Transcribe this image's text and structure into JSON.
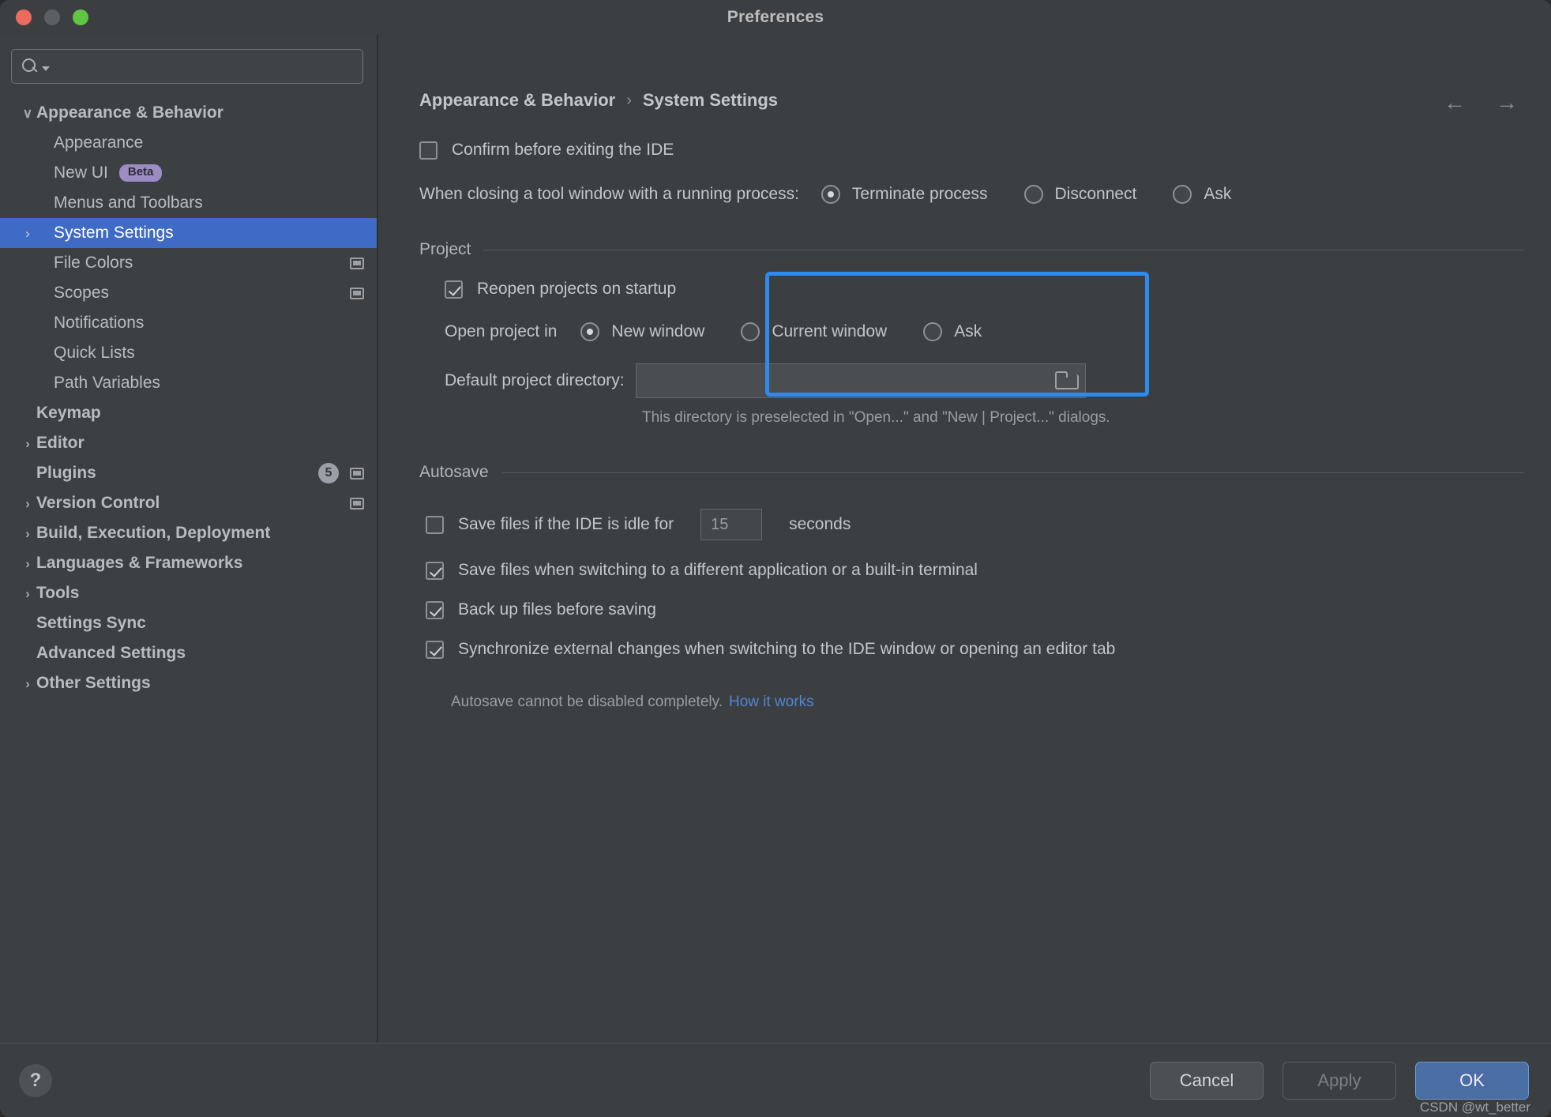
{
  "window": {
    "title": "Preferences",
    "traffic_lights": [
      "close",
      "minimize",
      "zoom"
    ]
  },
  "search": {
    "value": "",
    "placeholder": ""
  },
  "sidebar": {
    "items": [
      {
        "label": "Appearance & Behavior",
        "depth": 0,
        "arrow": "∨",
        "selected": false
      },
      {
        "label": "Appearance",
        "depth": 1,
        "arrow": "",
        "selected": false
      },
      {
        "label": "New UI",
        "depth": 1,
        "arrow": "",
        "selected": false,
        "badge": "Beta"
      },
      {
        "label": "Menus and Toolbars",
        "depth": 1,
        "arrow": "",
        "selected": false
      },
      {
        "label": "System Settings",
        "depth": 1,
        "arrow": "›",
        "selected": true
      },
      {
        "label": "File Colors",
        "depth": 1,
        "arrow": "",
        "selected": false,
        "scope_icon": true
      },
      {
        "label": "Scopes",
        "depth": 1,
        "arrow": "",
        "selected": false,
        "scope_icon": true
      },
      {
        "label": "Notifications",
        "depth": 1,
        "arrow": "",
        "selected": false
      },
      {
        "label": "Quick Lists",
        "depth": 1,
        "arrow": "",
        "selected": false
      },
      {
        "label": "Path Variables",
        "depth": 1,
        "arrow": "",
        "selected": false
      },
      {
        "label": "Keymap",
        "depth": 0,
        "arrow": "",
        "selected": false
      },
      {
        "label": "Editor",
        "depth": 0,
        "arrow": "›",
        "selected": false
      },
      {
        "label": "Plugins",
        "depth": 0,
        "arrow": "",
        "selected": false,
        "count": "5",
        "scope_icon": true
      },
      {
        "label": "Version Control",
        "depth": 0,
        "arrow": "›",
        "selected": false,
        "scope_icon": true
      },
      {
        "label": "Build, Execution, Deployment",
        "depth": 0,
        "arrow": "›",
        "selected": false
      },
      {
        "label": "Languages & Frameworks",
        "depth": 0,
        "arrow": "›",
        "selected": false
      },
      {
        "label": "Tools",
        "depth": 0,
        "arrow": "›",
        "selected": false
      },
      {
        "label": "Settings Sync",
        "depth": 0,
        "arrow": "",
        "selected": false
      },
      {
        "label": "Advanced Settings",
        "depth": 0,
        "arrow": "",
        "selected": false
      },
      {
        "label": "Other Settings",
        "depth": 0,
        "arrow": "›",
        "selected": false
      }
    ]
  },
  "breadcrumb": {
    "parent": "Appearance & Behavior",
    "separator": "›",
    "current": "System Settings"
  },
  "nav": {
    "back": "←",
    "forward": "→"
  },
  "main": {
    "confirm_exit": {
      "label": "Confirm before exiting the IDE",
      "checked": false
    },
    "closing_tool_window": {
      "label": "When closing a tool window with a running process:",
      "options": [
        {
          "label": "Terminate process",
          "selected": true
        },
        {
          "label": "Disconnect",
          "selected": false
        },
        {
          "label": "Ask",
          "selected": false
        }
      ]
    },
    "project": {
      "title": "Project",
      "reopen": {
        "label": "Reopen projects on startup",
        "checked": true
      },
      "open_project_in": {
        "label": "Open project in",
        "options": [
          {
            "label": "New window",
            "selected": true
          },
          {
            "label": "Current window",
            "selected": false
          },
          {
            "label": "Ask",
            "selected": false
          }
        ]
      },
      "default_directory": {
        "label": "Default project directory:",
        "value": "",
        "browse_icon": "folder-icon",
        "hint": "This directory is preselected in \"Open...\" and \"New | Project...\" dialogs."
      }
    },
    "autosave": {
      "title": "Autosave",
      "idle": {
        "label_before": "Save files if the IDE is idle for",
        "seconds": "15",
        "label_after": "seconds",
        "checked": false
      },
      "options": [
        {
          "label": "Save files when switching to a different application or a built-in terminal",
          "checked": true
        },
        {
          "label": "Back up files before saving",
          "checked": true
        },
        {
          "label": "Synchronize external changes when switching to the IDE window or opening an editor tab",
          "checked": true
        }
      ],
      "note": "Autosave cannot be disabled completely.",
      "note_link": "How it works"
    }
  },
  "footer": {
    "help": "?",
    "cancel": "Cancel",
    "apply": "Apply",
    "ok": "OK"
  },
  "watermark": "CSDN @wt_better",
  "colors": {
    "selection_blue": "#3f6bc4",
    "callout_blue": "#2e8aee",
    "link_blue": "#4e86d6",
    "beta_badge": "#9b8cc4",
    "ok_button": "#4a6da4"
  }
}
